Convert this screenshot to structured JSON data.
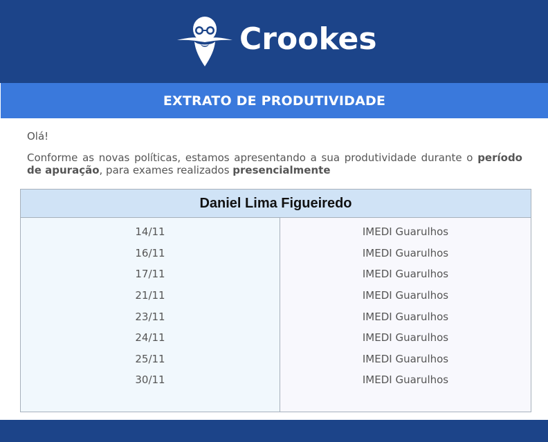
{
  "brand": {
    "name": "Crookes",
    "logo_icon": "bearded-scientist-icon",
    "colors": {
      "header": "#1c4489",
      "band": "#3a79dc",
      "card_head": "#d0e3f6"
    }
  },
  "banner": {
    "title": "EXTRATO DE PRODUTIVIDADE"
  },
  "message": {
    "greeting": "Olá!",
    "intro_part1": "Conforme as novas políticas, estamos apresentando a sua produtividade durante o ",
    "intro_bold1": "período de apuração",
    "intro_part2": ", para exames realizados ",
    "intro_bold2": "presencialmente"
  },
  "report": {
    "doctor_name": "Daniel Lima Figueiredo",
    "rows": [
      {
        "date": "14/11",
        "location": "IMEDI Guarulhos"
      },
      {
        "date": "16/11",
        "location": "IMEDI Guarulhos"
      },
      {
        "date": "17/11",
        "location": "IMEDI Guarulhos"
      },
      {
        "date": "21/11",
        "location": "IMEDI Guarulhos"
      },
      {
        "date": "23/11",
        "location": "IMEDI Guarulhos"
      },
      {
        "date": "24/11",
        "location": "IMEDI Guarulhos"
      },
      {
        "date": "25/11",
        "location": "IMEDI Guarulhos"
      },
      {
        "date": "30/11",
        "location": "IMEDI Guarulhos"
      }
    ]
  }
}
